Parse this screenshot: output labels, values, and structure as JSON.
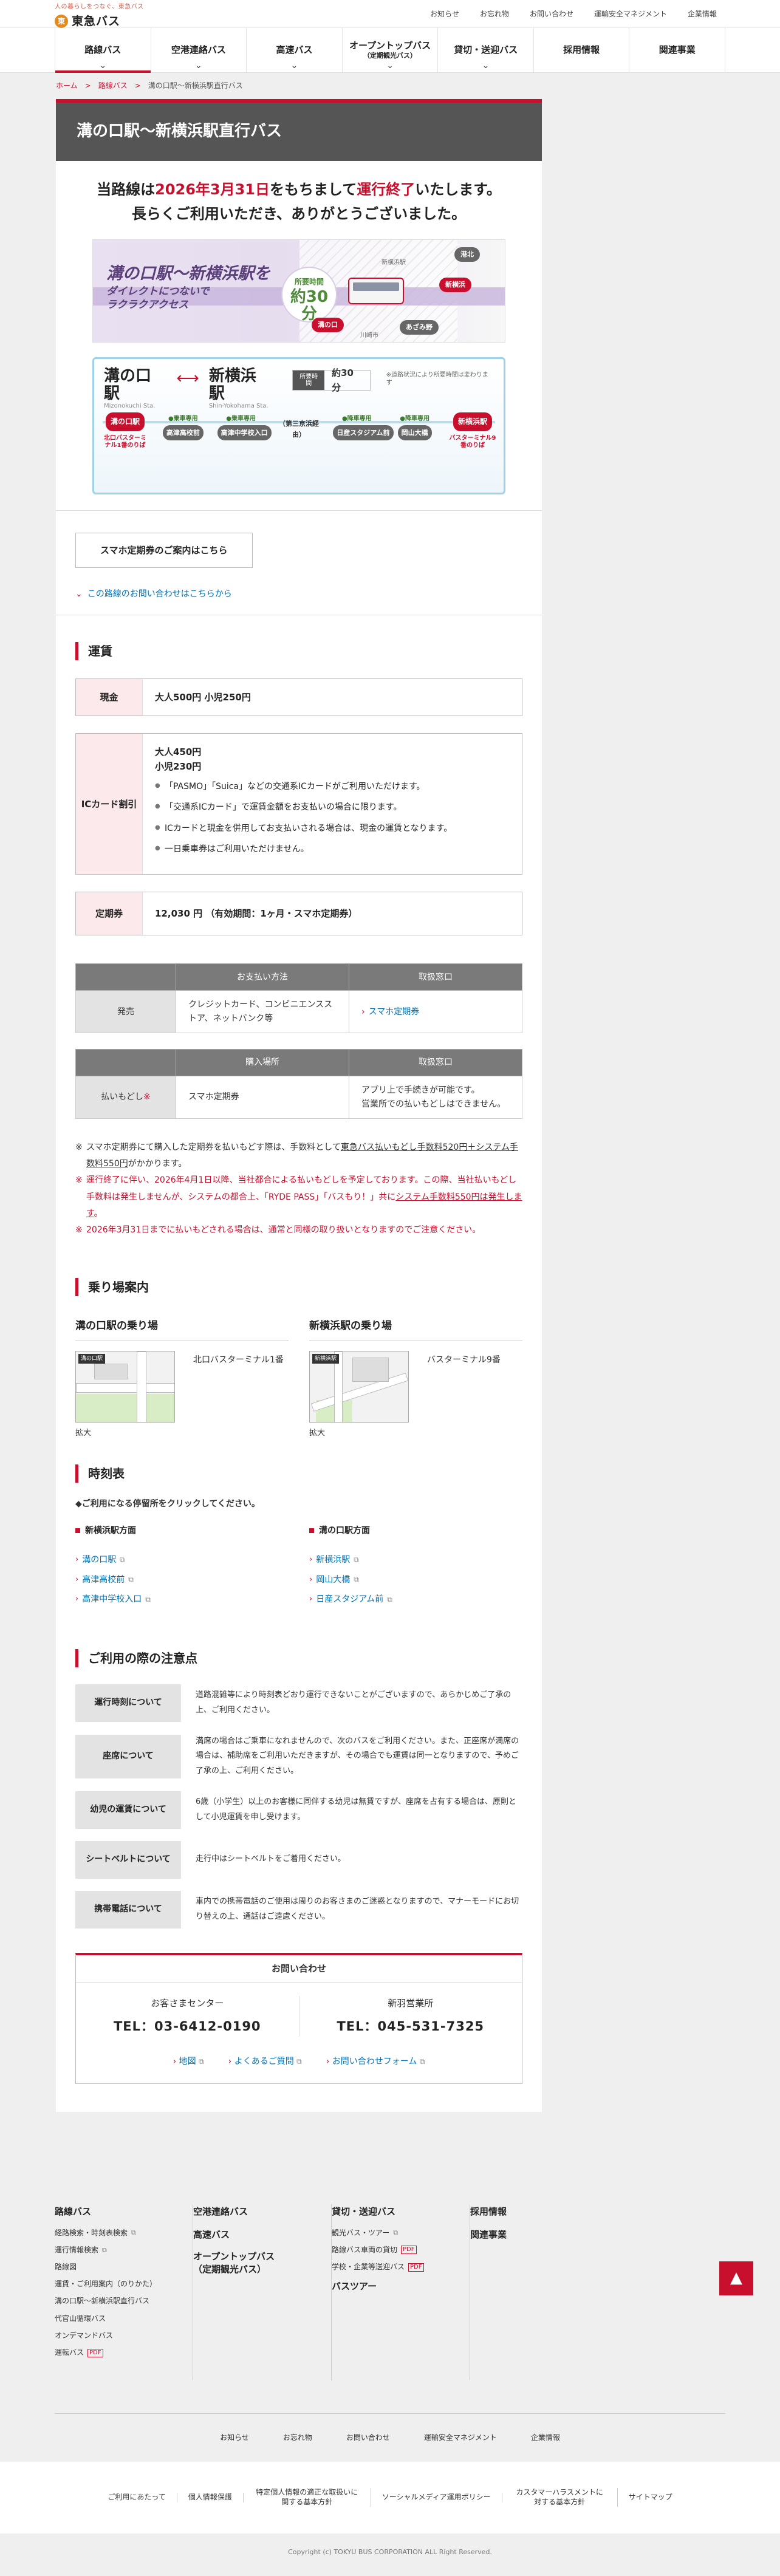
{
  "header": {
    "logo_tagline": "人の暮らしをつなぐ、東急バス",
    "logo_mark": "東",
    "logo_text": "東急バス",
    "util_links": [
      "お知らせ",
      "お忘れ物",
      "お問い合わせ",
      "運輸安全マネジメント",
      "企業情報"
    ]
  },
  "gnav": [
    {
      "label": "路線バス",
      "sub": "",
      "chevron": "⌄"
    },
    {
      "label": "空港連絡バス",
      "sub": "",
      "chevron": "⌄"
    },
    {
      "label": "高速バス",
      "sub": "",
      "chevron": "⌄"
    },
    {
      "label": "オープントップバス",
      "sub": "（定期観光バス）",
      "chevron": "⌄"
    },
    {
      "label": "貸切・送迎バス",
      "sub": "",
      "chevron": "⌄"
    },
    {
      "label": "採用情報",
      "sub": "",
      "chevron": ""
    },
    {
      "label": "関連事業",
      "sub": "",
      "chevron": ""
    }
  ],
  "breadcrumb": {
    "home": "ホーム",
    "parent": "路線バス",
    "current": "溝の口駅〜新横浜駅直行バス",
    "sep": ">"
  },
  "page_title": "溝の口駅〜新横浜駅直行バス",
  "notice": {
    "pre": "当路線は",
    "date": "2026年3月31日",
    "mid": "をもちまして",
    "end_word": "運行終了",
    "post": "いたします。",
    "line2": "長らくご利用いただき、ありがとうございました。"
  },
  "banner": {
    "copy_line1": "溝の口駅〜新横浜駅を",
    "copy_line2": "ダイレクトにつないで",
    "copy_line3": "ラクラクアクセス",
    "circle_small": "所要時間",
    "circle_num": "約30分",
    "pin_start": "溝の口",
    "pin_end": "新横浜",
    "pin_mid1": "あざみ野",
    "pin_mid2": "港北",
    "tag_city": "川崎市",
    "tag_area": "新横浜駅"
  },
  "routemap": {
    "from_name": "溝の口駅",
    "from_en": "Mizonokuchi Sta.",
    "arrow": "⟷",
    "to_name": "新横浜駅",
    "to_en": "Shin-Yokohama Sta.",
    "time_label": "所要時間",
    "time_value": "約30分",
    "note": "※道路状況により所要時間は変わります",
    "stops": [
      {
        "name": "溝の口駅",
        "top": "",
        "sub": "北口バスターミナル1番のりば",
        "term": true
      },
      {
        "name": "高津高校前",
        "top": "●乗車専用",
        "sub": "",
        "term": false
      },
      {
        "name": "高津中学校入口",
        "top": "●乗車専用",
        "sub": "",
        "term": false
      },
      {
        "name": "（第三京浜経由）",
        "top": "",
        "sub": "",
        "term": false
      },
      {
        "name": "日産スタジアム前",
        "top": "●降車専用",
        "sub": "",
        "term": false
      },
      {
        "name": "岡山大橋",
        "top": "●降車専用",
        "sub": "",
        "term": false
      },
      {
        "name": "新横浜駅",
        "top": "",
        "sub": "バスターミナル9番のりば",
        "term": true
      }
    ]
  },
  "teiki_button": "スマホ定期券のご案内はこちら",
  "inquiry_link": "この路線のお問い合わせはこちらから",
  "fare": {
    "title": "運賃",
    "cash_label": "現金",
    "cash_adult": "大人500円",
    "cash_child": "小児250円",
    "ic_label": "ICカード割引",
    "ic_adult": "大人450円",
    "ic_child": "小児230円",
    "ic_notes": [
      "「PASMO」「Suica」などの交通系ICカードがご利用いただけます。",
      "「交通系ICカード」で運賃金額をお支払いの場合に限ります。",
      "ICカードと現金を併用してお支払いされる場合は、現金の運賃となります。",
      "一日乗車券はご利用いただけません。"
    ],
    "pass_label": "定期券",
    "pass_value": "12,030 円 （有効期間：1ヶ月・スマホ定期券）"
  },
  "sales_table": {
    "h1": "お支払い方法",
    "h2": "取扱窓口",
    "row_head": "発売",
    "col1": "クレジットカード、コンビニエンスストア、ネットバンク等",
    "col2": "スマホ定期券"
  },
  "refund_table": {
    "h1": "購入場所",
    "h2": "取扱窓口",
    "row_head": "払いもどし",
    "mark": "※",
    "col1": "スマホ定期券",
    "col2_line1": "アプリ上で手続きが可能です。",
    "col2_line2": "営業所での払いもどしはできません。"
  },
  "notes": {
    "n1_pre": "スマホ定期券にて購入した定期券を払いもどす際は、手数料として",
    "n1_link": "東急バス払いもどし手数料520円＋システム手数料550円",
    "n1_post": "がかかります。",
    "n2_pre": "運行終了に伴い、2026年4月1日以降、当社都合による払いもどしを予定しております。この際、当社払いもどし手数料は発生しませんが、システムの都合上、「RYDE PASS」「バスもり！」共に",
    "n2_link": "システム手数料550円は発生します",
    "n2_post": "。",
    "n3": "2026年3月31日までに払いもどされる場合は、通常と同様の取り扱いとなりますのでご注意ください。"
  },
  "stops": {
    "title": "乗り場案内",
    "left_title": "溝の口駅の乗り場",
    "left_map_label": "溝の口駅",
    "left_desc": "北口バスターミナル1番",
    "right_title": "新横浜駅の乗り場",
    "right_map_label": "新横浜駅",
    "right_desc": "バスターミナル9番",
    "enlarge": "拡大"
  },
  "timetable": {
    "title": "時刻表",
    "lead": "◆ご利用になる停留所をクリックしてください。",
    "left_heading": "新横浜駅方面",
    "left_items": [
      "溝の口駅",
      "高津高校前",
      "高津中学校入口"
    ],
    "right_heading": "溝の口駅方面",
    "right_items": [
      "新横浜駅",
      "岡山大橋",
      "日産スタジアム前"
    ]
  },
  "caution": {
    "title": "ご利用の際の注意点",
    "rows": [
      {
        "label": "運行時刻について",
        "text": "道路混雑等により時刻表どおり運行できないことがございますので、あらかじめご了承の上、ご利用ください。"
      },
      {
        "label": "座席について",
        "text": "満席の場合はご乗車になれませんので、次のバスをご利用ください。また、正座席が満席の場合は、補助席をご利用いただきますが、その場合でも運賃は同一となりますので、予めご了承の上、ご利用ください。"
      },
      {
        "label": "幼児の運賃について",
        "text": "6歳（小学生）以上のお客様に同伴する幼児は無賃ですが、座席を占有する場合は、原則として小児運賃を申し受けます。"
      },
      {
        "label": "シートベルトについて",
        "text": "走行中はシートベルトをご着用ください。"
      },
      {
        "label": "携帯電話について",
        "text": "車内での携帯電話のご使用は周りのお客さまのご迷惑となりますので、マナーモードにお切り替えの上、通話はご遠慮ください。"
      }
    ]
  },
  "contact": {
    "title": "お問い合わせ",
    "left_name": "お客さまセンター",
    "left_tel": "TEL：03-6412-0190",
    "right_name": "新羽営業所",
    "right_tel": "TEL：045-531-7325",
    "links": [
      "地図",
      "よくあるご質問",
      "お問い合わせフォーム"
    ]
  },
  "footer": {
    "col1_title": "路線バス",
    "col1_items": [
      {
        "text": "経路検索・時刻表検索",
        "mark": "ext"
      },
      {
        "text": "運行情報検索",
        "mark": "ext"
      },
      {
        "text": "路線図",
        "mark": ""
      },
      {
        "text": "運賃・ご利用案内（のりかた）",
        "mark": ""
      },
      {
        "text": "溝の口駅〜新横浜駅直行バス",
        "mark": ""
      },
      {
        "text": "代官山循環バス",
        "mark": ""
      },
      {
        "text": "オンデマンドバス",
        "mark": ""
      },
      {
        "text": "運転バス",
        "mark": "pdf"
      }
    ],
    "col2_title1": "空港連絡バス",
    "col2_title2": "高速バス",
    "col2_title3a": "オープントップバス",
    "col2_title3b": "（定期観光バス）",
    "col3_title": "貸切・送迎バス",
    "col3_items": [
      {
        "text": "観光バス・ツアー",
        "mark": "ext"
      },
      {
        "text": "路線バス車両の貸切",
        "mark": "pdf"
      },
      {
        "text": "学校・企業等送迎バス",
        "mark": "pdf"
      }
    ],
    "col3_title2": "バスツアー",
    "col4_title1": "採用情報",
    "col4_title2": "関連事業",
    "pdf_label": "PDF",
    "ext_icon": "⧉",
    "totop": "▲",
    "nav": [
      "お知らせ",
      "お忘れ物",
      "お問い合わせ",
      "運輸安全マネジメント",
      "企業情報"
    ],
    "legal": [
      "ご利用にあたって",
      "個人情報保護",
      "特定個人情報の適正な取扱いに関する基本方針",
      "ソーシャルメディア運用ポリシー",
      "カスタマーハラスメントに対する基本方針",
      "サイトマップ"
    ],
    "copyright": "Copyright (c) TOKYU BUS CORPORATION ALL Right Reserved."
  }
}
